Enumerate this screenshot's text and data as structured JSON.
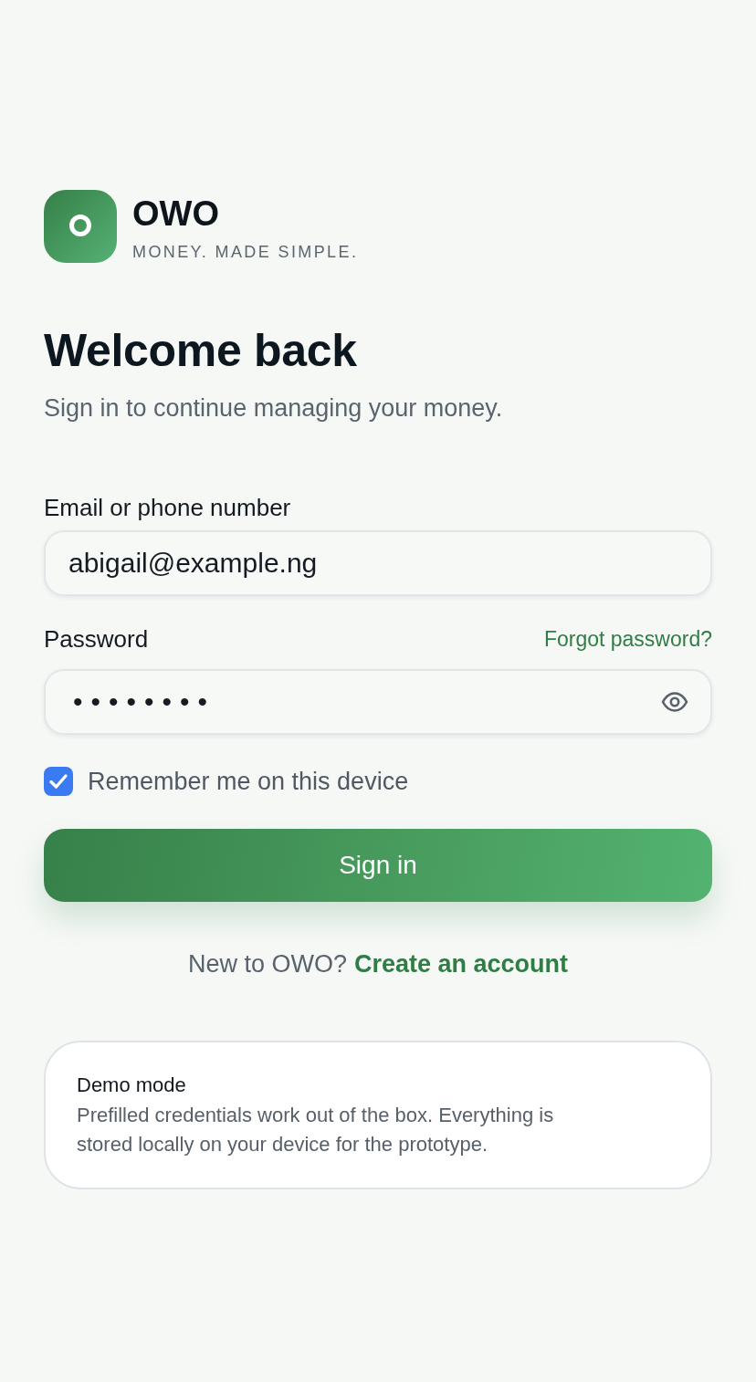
{
  "brand": {
    "name": "OWO",
    "tagline": "MONEY. MADE SIMPLE."
  },
  "heading": {
    "title": "Welcome back",
    "subtitle": "Sign in to continue managing your money."
  },
  "form": {
    "fields": [
      {
        "kind": "text",
        "label": "Email or phone number",
        "value": "abigail@example.ng"
      },
      {
        "kind": "password",
        "label": "Password",
        "link": "Forgot password?",
        "value": "••••••••"
      }
    ],
    "remember": {
      "label": "Remember me on this device",
      "checked": true
    },
    "submit": "Sign in"
  },
  "signup": {
    "prompt": "New to OWO?",
    "link": "Create an account"
  },
  "notice": {
    "title": "Demo mode",
    "body": "Prefilled credentials work out of the box. Everything is stored locally on your device for the prototype."
  }
}
